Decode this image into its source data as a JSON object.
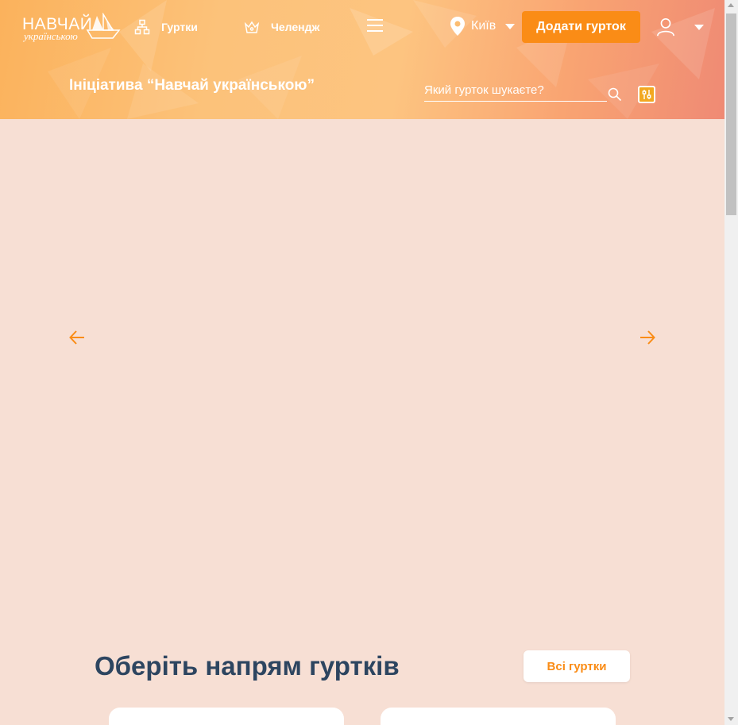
{
  "logo": {
    "line1": "НАВЧАЙ",
    "line2": "українською"
  },
  "nav": {
    "clubs_label": "Гуртки",
    "challenge_label": "Челендж"
  },
  "city": {
    "name": "Київ"
  },
  "header": {
    "add_club_label": "Додати гурток",
    "initiative_text": "Ініціатива “Навчай українською”",
    "search_placeholder": "Який гурток шукаєте?"
  },
  "directions": {
    "title": "Оберіть напрям гуртків",
    "all_clubs_label": "Всі гуртки"
  },
  "colors": {
    "accent": "#fa8c16",
    "title_text": "#2d4560",
    "page_bg": "#f7dfd4"
  },
  "icons": [
    "clubs-icon",
    "challenge-icon",
    "menu-icon",
    "location-pin-icon",
    "user-icon",
    "search-icon",
    "advanced-search-icon",
    "arrow-left-icon",
    "arrow-right-icon"
  ]
}
